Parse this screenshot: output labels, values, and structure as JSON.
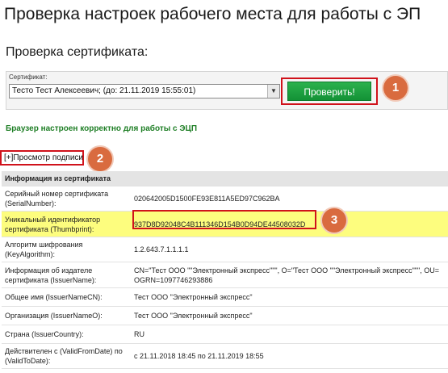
{
  "page_title": "Проверка настроек рабочего места для работы с ЭП",
  "section_title": "Проверка сертификата:",
  "certificate": {
    "label": "Сертификат:",
    "selected": "Тесто Тест Алексеевич; (до: 21.11.2019 15:55:01)"
  },
  "check_button": "Проверить!",
  "status_message": "Браузер настроен корректно для работы с ЭЦП",
  "toggle_label": "[+]Просмотр подписи",
  "markers": [
    "1",
    "2",
    "3"
  ],
  "table": {
    "header": "Информация из сертификата",
    "rows": [
      {
        "label": "Серийный номер сертификата (SerialNumber):",
        "value": "020642005D1500FE93E811A5ED97C962BA"
      },
      {
        "label": "Уникальный идентификатор сертификата (Thumbprint):",
        "value": "937D8D92048C4B111346D154B0D94DE44508032D"
      },
      {
        "label": "Алгоритм шифрования (KeyAlgorithm):",
        "value": "1.2.643.7.1.1.1.1"
      },
      {
        "label": "Информация об издателе сертификата (IssuerName):",
        "value": "CN=\"Тест ООО \"\"Электронный экспресс\"\"\", O=\"Тест ООО \"\"Электронный экспресс\"\"\", OU=",
        "value2": "OGRN=1097746293886"
      },
      {
        "label": "Общее имя (IssuerNameCN):",
        "value": "Тест ООО \"Электронный экспресс\""
      },
      {
        "label": "Организация (IssuerNameO):",
        "value": "Тест ООО \"Электронный экспресс\""
      },
      {
        "label": "Страна (IssuerCountry):",
        "value": "RU"
      },
      {
        "label": "Действителен с (ValidFromDate) по (ValidToDate):",
        "value": "с 21.11.2018 18:45 по 21.11.2019 18:55"
      }
    ]
  },
  "colors": {
    "highlight_row": "#fdfd7e",
    "button_green": "#139236",
    "status_green": "#1e7e25",
    "annotation_border": "#d0121b",
    "marker_orange": "#d96b3f"
  }
}
